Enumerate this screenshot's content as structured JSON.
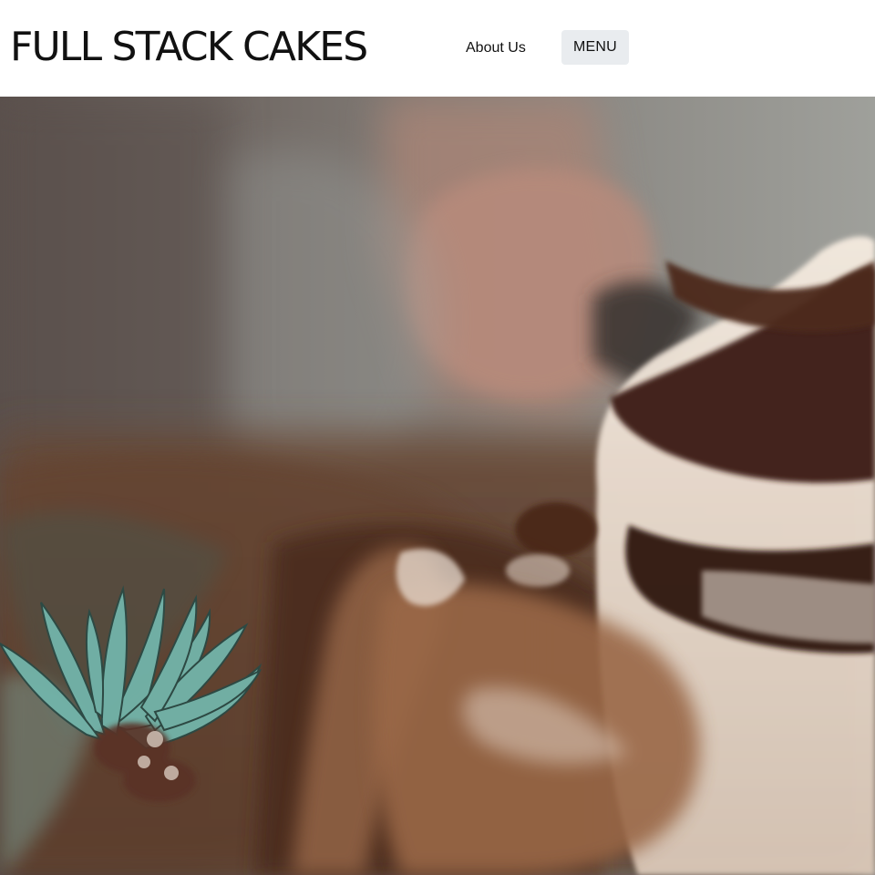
{
  "header": {
    "site_title": "FULL STACK CAKES",
    "nav_about_label": "About Us",
    "menu_label": "MENU"
  },
  "colors": {
    "header_background": "#ffffff",
    "title_text": "#111111",
    "menu_button_background": "#e9ecef"
  },
  "hero": {
    "image_description_icon": "cake-photo-image"
  }
}
